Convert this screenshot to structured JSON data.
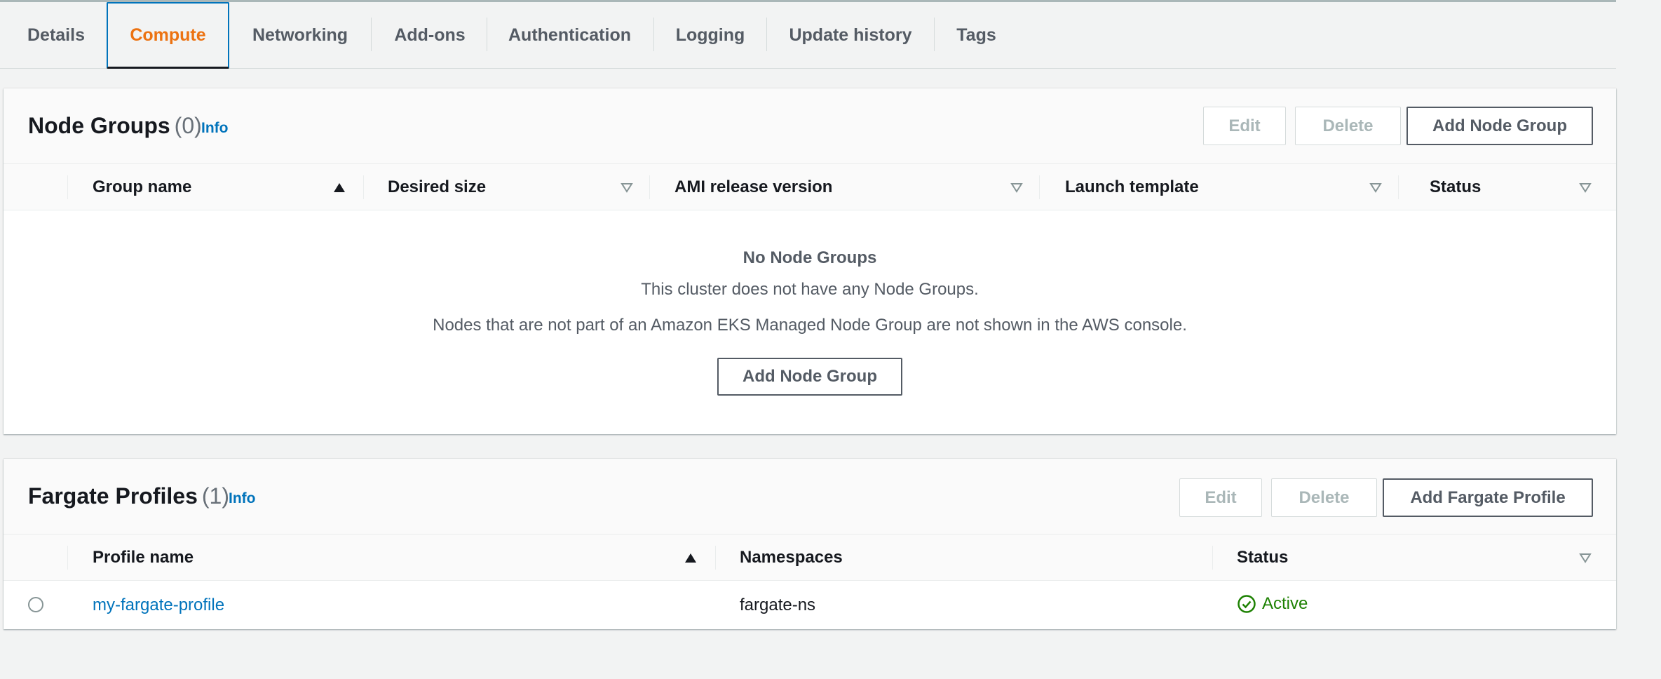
{
  "tabs": [
    {
      "label": "Details",
      "active": false
    },
    {
      "label": "Compute",
      "active": true
    },
    {
      "label": "Networking",
      "active": false
    },
    {
      "label": "Add-ons",
      "active": false
    },
    {
      "label": "Authentication",
      "active": false
    },
    {
      "label": "Logging",
      "active": false
    },
    {
      "label": "Update history",
      "active": false
    },
    {
      "label": "Tags",
      "active": false
    }
  ],
  "node_groups": {
    "title": "Node Groups",
    "count": "(0)",
    "info": "Info",
    "buttons": {
      "edit": "Edit",
      "delete": "Delete",
      "add": "Add Node Group"
    },
    "columns": [
      "Group name",
      "Desired size",
      "AMI release version",
      "Launch template",
      "Status"
    ],
    "empty": {
      "title": "No Node Groups",
      "line1": "This cluster does not have any Node Groups.",
      "line2": "Nodes that are not part of an Amazon EKS Managed Node Group are not shown in the AWS console.",
      "button": "Add Node Group"
    }
  },
  "fargate_profiles": {
    "title": "Fargate Profiles",
    "count": "(1)",
    "info": "Info",
    "buttons": {
      "edit": "Edit",
      "delete": "Delete",
      "add": "Add Fargate Profile"
    },
    "columns": [
      "Profile name",
      "Namespaces",
      "Status"
    ],
    "rows": [
      {
        "profile_name": "my-fargate-profile",
        "namespaces": "fargate-ns",
        "status": "Active"
      }
    ]
  },
  "colors": {
    "active_tab": "#ec7211",
    "link": "#0073bb",
    "status_active": "#1d8102"
  },
  "icons": {
    "sort_ascending": "triangle-up-filled",
    "sort_unsorted": "triangle-down-outline",
    "status_ok": "check-circle"
  }
}
